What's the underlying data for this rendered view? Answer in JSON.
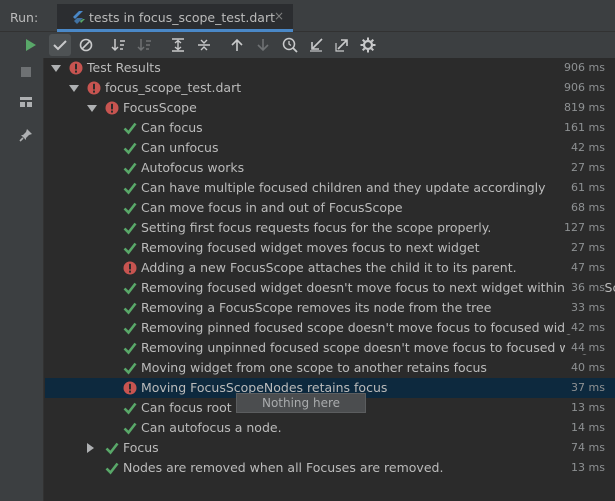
{
  "header": {
    "run_label": "Run:",
    "tab_title": "tests in focus_scope_test.dart",
    "tab_close": "×"
  },
  "colors": {
    "pass": "#59a869",
    "fail": "#c75450",
    "accent": "#4a88c7",
    "selected_row": "#0d293e"
  },
  "toolbar": {
    "buttons": [
      {
        "icon": "rerun-icon"
      },
      {
        "icon": "show-passed-icon",
        "active": true
      },
      {
        "icon": "show-ignored-icon"
      },
      {
        "icon": "sort-alphabetically-icon"
      },
      {
        "icon": "sort-by-duration-icon"
      },
      {
        "icon": "expand-all-icon"
      },
      {
        "icon": "collapse-all-icon"
      },
      {
        "icon": "previous-failed-icon"
      },
      {
        "icon": "next-failed-icon"
      },
      {
        "icon": "history-icon"
      },
      {
        "icon": "import-tests-icon"
      },
      {
        "icon": "export-tests-icon"
      },
      {
        "icon": "settings-icon"
      }
    ]
  },
  "sidebar": {
    "buttons": [
      {
        "icon": "stop-icon"
      },
      {
        "icon": "layout-icon"
      },
      {
        "icon": "pin-icon"
      }
    ]
  },
  "tree": {
    "rows": [
      {
        "label": "Test Results",
        "duration": "906 ms",
        "status": "fail",
        "level": 0,
        "expander": "down"
      },
      {
        "label": "focus_scope_test.dart",
        "duration": "906 ms",
        "status": "fail",
        "level": 1,
        "expander": "down"
      },
      {
        "label": "FocusScope",
        "duration": "819 ms",
        "status": "fail",
        "level": 2,
        "expander": "down"
      },
      {
        "label": "Can focus",
        "duration": "161 ms",
        "status": "pass",
        "level": 3
      },
      {
        "label": "Can unfocus",
        "duration": "42 ms",
        "status": "pass",
        "level": 3
      },
      {
        "label": "Autofocus works",
        "duration": "27 ms",
        "status": "pass",
        "level": 3
      },
      {
        "label": "Can have multiple focused children and they update accordingly",
        "duration": "61 ms",
        "status": "pass",
        "level": 3
      },
      {
        "label": "Can move focus in and out of FocusScope",
        "duration": "68 ms",
        "status": "pass",
        "level": 3
      },
      {
        "label": "Setting first focus requests focus for the scope properly.",
        "duration": "127 ms",
        "status": "pass",
        "level": 3
      },
      {
        "label": "Removing focused widget moves focus to next widget",
        "duration": "27 ms",
        "status": "pass",
        "level": 3
      },
      {
        "label": "Adding a new FocusScope attaches the child it to its parent.",
        "duration": "47 ms",
        "status": "fail",
        "level": 3
      },
      {
        "label": "Removing focused widget doesn't move focus to next widget within FocusScope",
        "duration": "36 ms",
        "status": "pass",
        "level": 3
      },
      {
        "label": "Removing a FocusScope removes its node from the tree",
        "duration": "33 ms",
        "status": "pass",
        "level": 3
      },
      {
        "label": "Removing pinned focused scope doesn't move focus to focused widget",
        "duration": "42 ms",
        "status": "pass",
        "level": 3
      },
      {
        "label": "Removing unpinned focused scope doesn't move focus to focused widget",
        "duration": "44 ms",
        "status": "pass",
        "level": 3
      },
      {
        "label": "Moving widget from one scope to another retains focus",
        "duration": "40 ms",
        "status": "pass",
        "level": 3
      },
      {
        "label": "Moving FocusScopeNodes retains focus",
        "duration": "37 ms",
        "status": "fail",
        "level": 3,
        "selected": true
      },
      {
        "label": "Can focus root node.",
        "duration": "13 ms",
        "status": "pass",
        "level": 3
      },
      {
        "label": "Can autofocus a node.",
        "duration": "14 ms",
        "status": "pass",
        "level": 3
      },
      {
        "label": "Focus",
        "duration": "74 ms",
        "status": "pass",
        "level": 2,
        "expander": "right"
      },
      {
        "label": "Nodes are removed when all Focuses are removed.",
        "duration": "13 ms",
        "status": "pass",
        "level": 2
      }
    ]
  },
  "tooltip": {
    "text": "Nothing here"
  }
}
